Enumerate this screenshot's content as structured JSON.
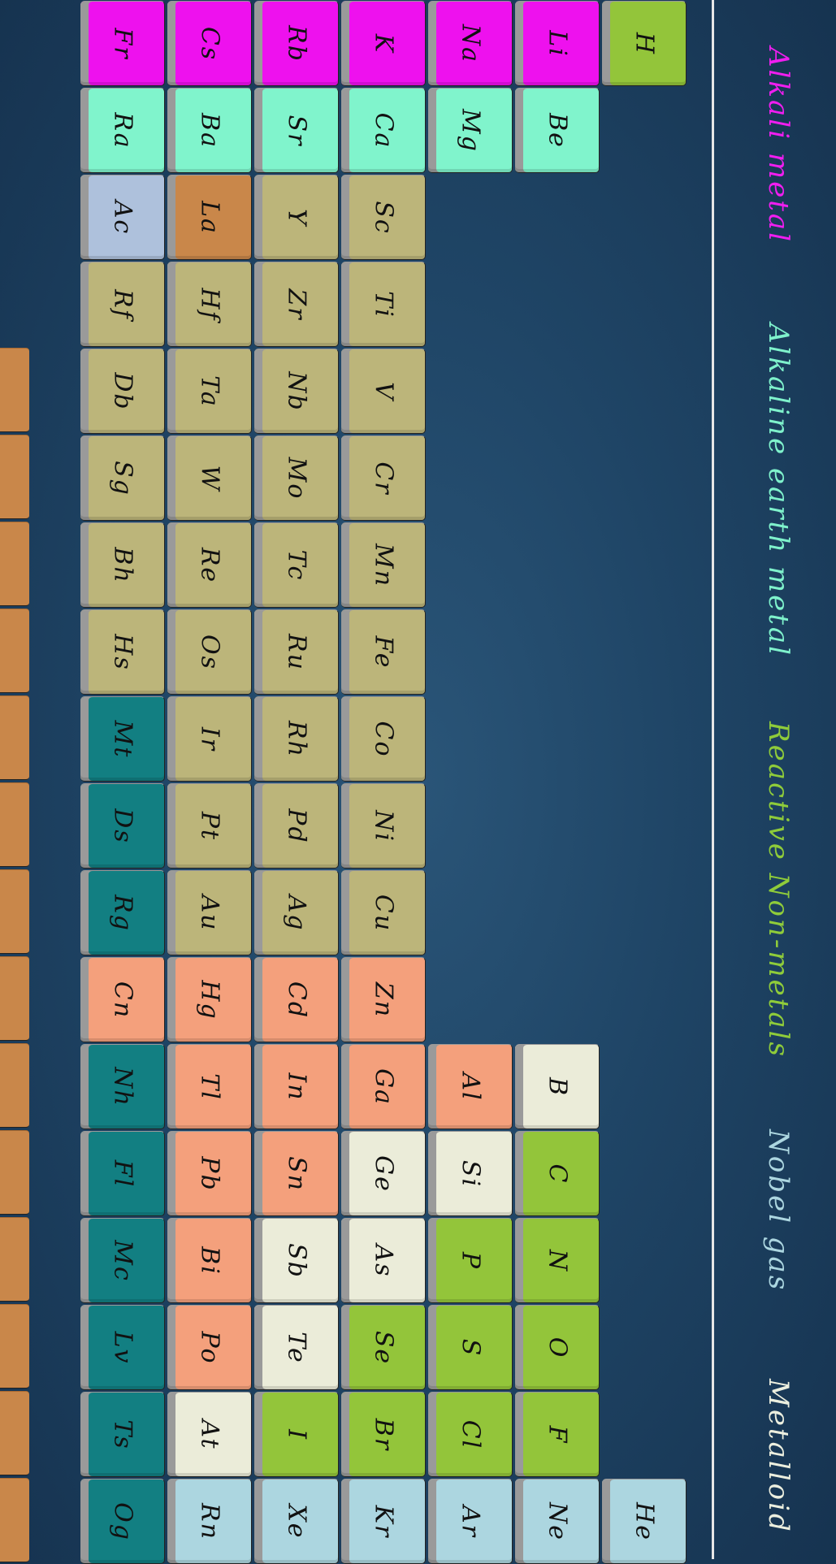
{
  "categories": {
    "alkali": {
      "label": "Alkali metal",
      "color": "#ee11ee",
      "text_color": "#f01ef0"
    },
    "alkaline": {
      "label": "Alkaline earth metal",
      "color": "#80f4cc",
      "text_color": "#7ff2cc"
    },
    "nonmetal": {
      "label": "Reactive Non-metals",
      "color": "#93c53a",
      "text_color": "#8fcc3a"
    },
    "noble": {
      "label": "Nobel gas",
      "color": "#acd6e0",
      "text_color": "#acd6e0"
    },
    "metalloid": {
      "label": "Metalloid",
      "color": "#ebecd9",
      "text_color": "#ecefdf"
    },
    "transition": {
      "color": "#bcb57a"
    },
    "post": {
      "color": "#f4a07c"
    },
    "unknown": {
      "color": "#127f82"
    },
    "lanthanide": {
      "color": "#c9874a"
    },
    "actinide": {
      "color": "#aec1dc"
    }
  },
  "legend": [
    "alkali",
    "alkaline",
    "nonmetal",
    "noble",
    "metalloid"
  ],
  "elements": [
    {
      "symbol": "H",
      "col": 1,
      "row": 1,
      "cat": "nonmetal"
    },
    {
      "symbol": "Li",
      "col": 1,
      "row": 2,
      "cat": "alkali"
    },
    {
      "symbol": "Na",
      "col": 1,
      "row": 3,
      "cat": "alkali"
    },
    {
      "symbol": "K",
      "col": 1,
      "row": 4,
      "cat": "alkali"
    },
    {
      "symbol": "Rb",
      "col": 1,
      "row": 5,
      "cat": "alkali"
    },
    {
      "symbol": "Cs",
      "col": 1,
      "row": 6,
      "cat": "alkali"
    },
    {
      "symbol": "Fr",
      "col": 1,
      "row": 7,
      "cat": "alkali"
    },
    {
      "symbol": "Be",
      "col": 2,
      "row": 2,
      "cat": "alkaline"
    },
    {
      "symbol": "Mg",
      "col": 2,
      "row": 3,
      "cat": "alkaline"
    },
    {
      "symbol": "Ca",
      "col": 2,
      "row": 4,
      "cat": "alkaline"
    },
    {
      "symbol": "Sr",
      "col": 2,
      "row": 5,
      "cat": "alkaline"
    },
    {
      "symbol": "Ba",
      "col": 2,
      "row": 6,
      "cat": "alkaline"
    },
    {
      "symbol": "Ra",
      "col": 2,
      "row": 7,
      "cat": "alkaline"
    },
    {
      "symbol": "Sc",
      "col": 3,
      "row": 4,
      "cat": "transition"
    },
    {
      "symbol": "Y",
      "col": 3,
      "row": 5,
      "cat": "transition"
    },
    {
      "symbol": "La",
      "col": 3,
      "row": 6,
      "cat": "lanthanide"
    },
    {
      "symbol": "Ac",
      "col": 3,
      "row": 7,
      "cat": "actinide"
    },
    {
      "symbol": "Ti",
      "col": 4,
      "row": 4,
      "cat": "transition"
    },
    {
      "symbol": "Zr",
      "col": 4,
      "row": 5,
      "cat": "transition"
    },
    {
      "symbol": "Hf",
      "col": 4,
      "row": 6,
      "cat": "transition"
    },
    {
      "symbol": "Rf",
      "col": 4,
      "row": 7,
      "cat": "transition"
    },
    {
      "symbol": "V",
      "col": 5,
      "row": 4,
      "cat": "transition"
    },
    {
      "symbol": "Nb",
      "col": 5,
      "row": 5,
      "cat": "transition"
    },
    {
      "symbol": "Ta",
      "col": 5,
      "row": 6,
      "cat": "transition"
    },
    {
      "symbol": "Db",
      "col": 5,
      "row": 7,
      "cat": "transition"
    },
    {
      "symbol": "Cr",
      "col": 6,
      "row": 4,
      "cat": "transition"
    },
    {
      "symbol": "Mo",
      "col": 6,
      "row": 5,
      "cat": "transition"
    },
    {
      "symbol": "W",
      "col": 6,
      "row": 6,
      "cat": "transition"
    },
    {
      "symbol": "Sg",
      "col": 6,
      "row": 7,
      "cat": "transition"
    },
    {
      "symbol": "Mn",
      "col": 7,
      "row": 4,
      "cat": "transition"
    },
    {
      "symbol": "Tc",
      "col": 7,
      "row": 5,
      "cat": "transition"
    },
    {
      "symbol": "Re",
      "col": 7,
      "row": 6,
      "cat": "transition"
    },
    {
      "symbol": "Bh",
      "col": 7,
      "row": 7,
      "cat": "transition"
    },
    {
      "symbol": "Fe",
      "col": 8,
      "row": 4,
      "cat": "transition"
    },
    {
      "symbol": "Ru",
      "col": 8,
      "row": 5,
      "cat": "transition"
    },
    {
      "symbol": "Os",
      "col": 8,
      "row": 6,
      "cat": "transition"
    },
    {
      "symbol": "Hs",
      "col": 8,
      "row": 7,
      "cat": "transition"
    },
    {
      "symbol": "Co",
      "col": 9,
      "row": 4,
      "cat": "transition"
    },
    {
      "symbol": "Rh",
      "col": 9,
      "row": 5,
      "cat": "transition"
    },
    {
      "symbol": "Ir",
      "col": 9,
      "row": 6,
      "cat": "transition"
    },
    {
      "symbol": "Mt",
      "col": 9,
      "row": 7,
      "cat": "unknown"
    },
    {
      "symbol": "Ni",
      "col": 10,
      "row": 4,
      "cat": "transition"
    },
    {
      "symbol": "Pd",
      "col": 10,
      "row": 5,
      "cat": "transition"
    },
    {
      "symbol": "Pt",
      "col": 10,
      "row": 6,
      "cat": "transition"
    },
    {
      "symbol": "Ds",
      "col": 10,
      "row": 7,
      "cat": "unknown"
    },
    {
      "symbol": "Cu",
      "col": 11,
      "row": 4,
      "cat": "transition"
    },
    {
      "symbol": "Ag",
      "col": 11,
      "row": 5,
      "cat": "transition"
    },
    {
      "symbol": "Au",
      "col": 11,
      "row": 6,
      "cat": "transition"
    },
    {
      "symbol": "Rg",
      "col": 11,
      "row": 7,
      "cat": "unknown"
    },
    {
      "symbol": "Zn",
      "col": 12,
      "row": 4,
      "cat": "post"
    },
    {
      "symbol": "Cd",
      "col": 12,
      "row": 5,
      "cat": "post"
    },
    {
      "symbol": "Hg",
      "col": 12,
      "row": 6,
      "cat": "post"
    },
    {
      "symbol": "Cn",
      "col": 12,
      "row": 7,
      "cat": "post"
    },
    {
      "symbol": "B",
      "col": 13,
      "row": 2,
      "cat": "metalloid"
    },
    {
      "symbol": "Al",
      "col": 13,
      "row": 3,
      "cat": "post"
    },
    {
      "symbol": "Ga",
      "col": 13,
      "row": 4,
      "cat": "post"
    },
    {
      "symbol": "In",
      "col": 13,
      "row": 5,
      "cat": "post"
    },
    {
      "symbol": "Tl",
      "col": 13,
      "row": 6,
      "cat": "post"
    },
    {
      "symbol": "Nh",
      "col": 13,
      "row": 7,
      "cat": "unknown"
    },
    {
      "symbol": "C",
      "col": 14,
      "row": 2,
      "cat": "nonmetal"
    },
    {
      "symbol": "Si",
      "col": 14,
      "row": 3,
      "cat": "metalloid"
    },
    {
      "symbol": "Ge",
      "col": 14,
      "row": 4,
      "cat": "metalloid"
    },
    {
      "symbol": "Sn",
      "col": 14,
      "row": 5,
      "cat": "post"
    },
    {
      "symbol": "Pb",
      "col": 14,
      "row": 6,
      "cat": "post"
    },
    {
      "symbol": "Fl",
      "col": 14,
      "row": 7,
      "cat": "unknown"
    },
    {
      "symbol": "N",
      "col": 15,
      "row": 2,
      "cat": "nonmetal"
    },
    {
      "symbol": "P",
      "col": 15,
      "row": 3,
      "cat": "nonmetal"
    },
    {
      "symbol": "As",
      "col": 15,
      "row": 4,
      "cat": "metalloid"
    },
    {
      "symbol": "Sb",
      "col": 15,
      "row": 5,
      "cat": "metalloid"
    },
    {
      "symbol": "Bi",
      "col": 15,
      "row": 6,
      "cat": "post"
    },
    {
      "symbol": "Mc",
      "col": 15,
      "row": 7,
      "cat": "unknown"
    },
    {
      "symbol": "O",
      "col": 16,
      "row": 2,
      "cat": "nonmetal"
    },
    {
      "symbol": "S",
      "col": 16,
      "row": 3,
      "cat": "nonmetal"
    },
    {
      "symbol": "Se",
      "col": 16,
      "row": 4,
      "cat": "nonmetal"
    },
    {
      "symbol": "Te",
      "col": 16,
      "row": 5,
      "cat": "metalloid"
    },
    {
      "symbol": "Po",
      "col": 16,
      "row": 6,
      "cat": "post"
    },
    {
      "symbol": "Lv",
      "col": 16,
      "row": 7,
      "cat": "unknown"
    },
    {
      "symbol": "F",
      "col": 17,
      "row": 2,
      "cat": "nonmetal"
    },
    {
      "symbol": "Cl",
      "col": 17,
      "row": 3,
      "cat": "nonmetal"
    },
    {
      "symbol": "Br",
      "col": 17,
      "row": 4,
      "cat": "nonmetal"
    },
    {
      "symbol": "I",
      "col": 17,
      "row": 5,
      "cat": "nonmetal"
    },
    {
      "symbol": "At",
      "col": 17,
      "row": 6,
      "cat": "metalloid"
    },
    {
      "symbol": "Ts",
      "col": 17,
      "row": 7,
      "cat": "unknown"
    },
    {
      "symbol": "He",
      "col": 18,
      "row": 1,
      "cat": "noble"
    },
    {
      "symbol": "Ne",
      "col": 18,
      "row": 2,
      "cat": "noble"
    },
    {
      "symbol": "Ar",
      "col": 18,
      "row": 3,
      "cat": "noble"
    },
    {
      "symbol": "Kr",
      "col": 18,
      "row": 4,
      "cat": "noble"
    },
    {
      "symbol": "Xe",
      "col": 18,
      "row": 5,
      "cat": "noble"
    },
    {
      "symbol": "Rn",
      "col": 18,
      "row": 6,
      "cat": "noble"
    },
    {
      "symbol": "Og",
      "col": 18,
      "row": 7,
      "cat": "unknown"
    }
  ]
}
